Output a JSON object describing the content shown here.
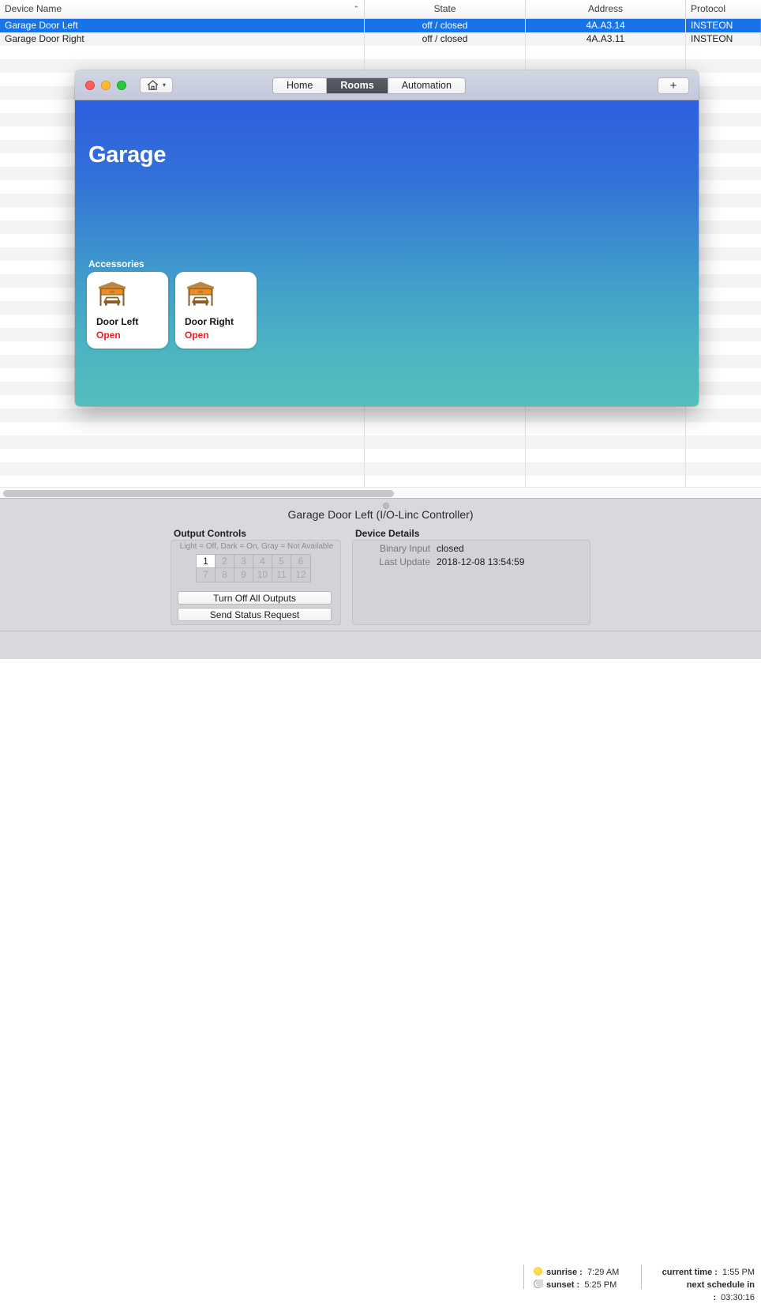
{
  "device_table": {
    "columns": [
      {
        "key": "name",
        "label": "Device Name",
        "align": "left",
        "sorted": true,
        "sort_glyph": "⌃"
      },
      {
        "key": "state",
        "label": "State",
        "align": "center"
      },
      {
        "key": "address",
        "label": "Address",
        "align": "center"
      },
      {
        "key": "protocol",
        "label": "Protocol",
        "align": "left"
      }
    ],
    "rows": [
      {
        "name": "Garage Door Left",
        "state": "off / closed",
        "address": "4A.A3.14",
        "protocol": "INSTEON",
        "selected": true
      },
      {
        "name": "Garage Door Right",
        "state": "off / closed",
        "address": "4A.A3.11",
        "protocol": "INSTEON",
        "selected": false
      }
    ],
    "selection_color": "#1873e8",
    "empty_row_count": 33
  },
  "detail_panel": {
    "title": "Garage Door Left (I/O-Linc Controller)",
    "output_controls": {
      "heading": "Output Controls",
      "legend": "Light = Off, Dark = On, Gray = Not Available",
      "cells": [
        {
          "label": "1",
          "state": "off"
        },
        {
          "label": "2",
          "state": "na"
        },
        {
          "label": "3",
          "state": "na"
        },
        {
          "label": "4",
          "state": "na"
        },
        {
          "label": "5",
          "state": "na"
        },
        {
          "label": "6",
          "state": "na"
        },
        {
          "label": "7",
          "state": "na"
        },
        {
          "label": "8",
          "state": "na"
        },
        {
          "label": "9",
          "state": "na"
        },
        {
          "label": "10",
          "state": "na"
        },
        {
          "label": "11",
          "state": "na"
        },
        {
          "label": "12",
          "state": "na"
        }
      ],
      "turn_off_all_label": "Turn Off All Outputs",
      "send_status_label": "Send Status Request"
    },
    "device_details": {
      "heading": "Device Details",
      "fields": [
        {
          "label": "Binary Input",
          "value": "closed"
        },
        {
          "label": "Last Update",
          "value": "2018-12-08 13:54:59"
        }
      ]
    }
  },
  "status_bar": {
    "sunrise_label": "sunrise :",
    "sunrise_value": "7:29 AM",
    "sunset_label": "sunset :",
    "sunset_value": "5:25 PM",
    "current_time_label": "current time :",
    "current_time_value": "1:55 PM",
    "next_schedule_label": "next schedule in :",
    "next_schedule_value": "03:30:16",
    "sunrise_icon": "sun-icon",
    "sunset_icon": "moon-icon"
  },
  "home_window": {
    "traffic_lights": {
      "close": "close-button",
      "minimize": "minimize-button",
      "maximize": "maximize-button"
    },
    "home_menu": {
      "icon": "home-icon",
      "chevron": "▾"
    },
    "tabs": [
      {
        "label": "Home",
        "active": false
      },
      {
        "label": "Rooms",
        "active": true
      },
      {
        "label": "Automation",
        "active": false
      }
    ],
    "add_button_label": "+",
    "room": {
      "title": "Garage",
      "accessories_label": "Accessories",
      "accessories": [
        {
          "name": "Door Left",
          "state": "Open",
          "icon": "garage-door-open-icon"
        },
        {
          "name": "Door Right",
          "state": "Open",
          "icon": "garage-door-open-icon"
        }
      ],
      "state_color": "#ee1b24",
      "gradient_top": "#2e5ee0",
      "gradient_bottom": "#53bfbd"
    }
  }
}
